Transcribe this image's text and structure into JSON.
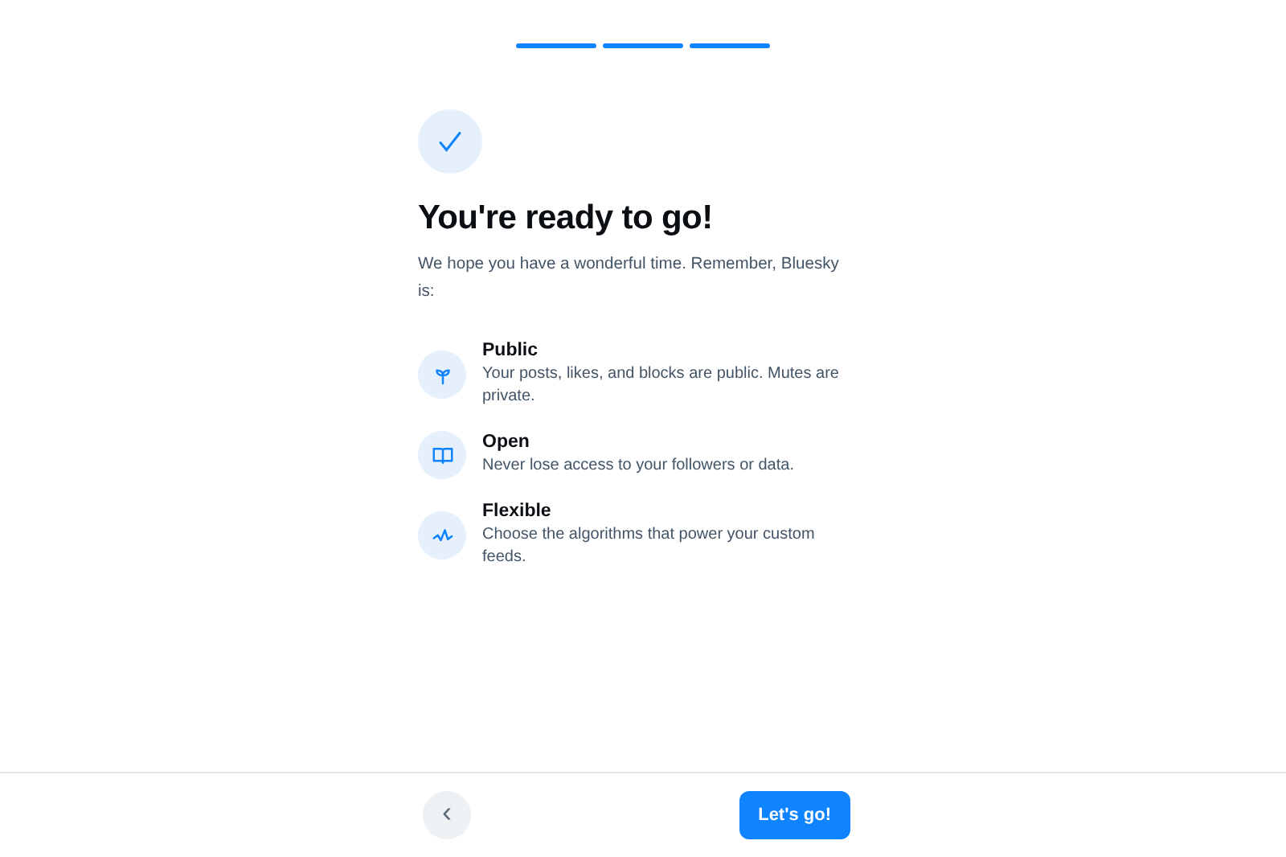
{
  "progress": [
    {
      "done": true
    },
    {
      "done": true
    },
    {
      "done": true
    }
  ],
  "title": "You're ready to go!",
  "subtitle": "We hope you have a wonderful time. Remember, Bluesky is:",
  "features": [
    {
      "title": "Public",
      "description": "Your posts, likes, and blocks are public. Mutes are private."
    },
    {
      "title": "Open",
      "description": "Never lose access to your followers or data."
    },
    {
      "title": "Flexible",
      "description": "Choose the algorithms that power your custom feeds."
    }
  ],
  "footer": {
    "back_button": "‹",
    "next_button": "Let's go!"
  }
}
